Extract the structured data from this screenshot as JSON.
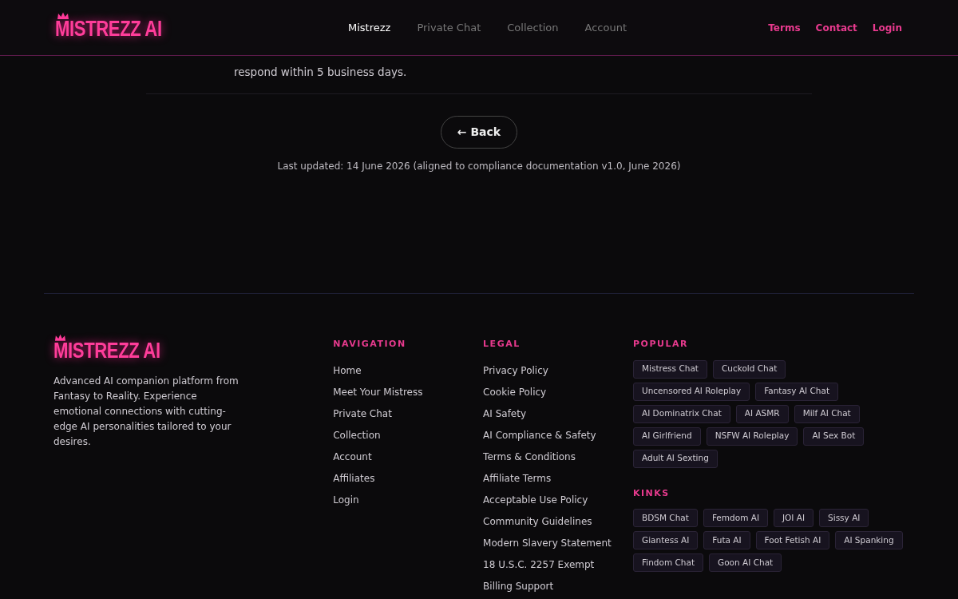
{
  "header": {
    "logo": "MISTREZZ AI",
    "nav": [
      {
        "label": "Mistrezz",
        "selected": true
      },
      {
        "label": "Private Chat",
        "selected": false
      },
      {
        "label": "Collection",
        "selected": false
      },
      {
        "label": "Account",
        "selected": false
      }
    ],
    "links": [
      "Terms",
      "Contact",
      "Login"
    ]
  },
  "content": {
    "paragraph": "respond within 5 business days.",
    "back_button": "← Back",
    "last_updated": "Last updated: 14 June 2026 (aligned to compliance documentation v1.0, June 2026)"
  },
  "footer": {
    "logo": "MISTREZZ AI",
    "description": "Advanced AI companion platform from Fantasy to Reality. Experience emotional connections with cutting-edge AI personalities tailored to your desires.",
    "columns": [
      {
        "title": "NAVIGATION",
        "links": [
          "Home",
          "Meet Your Mistress",
          "Private Chat",
          "Collection",
          "Account",
          "Affiliates",
          "Login"
        ]
      },
      {
        "title": "LEGAL",
        "links": [
          "Privacy Policy",
          "Cookie Policy",
          "AI Safety",
          "AI Compliance & Safety",
          "Terms & Conditions",
          "Affiliate Terms",
          "Acceptable Use Policy",
          "Community Guidelines",
          "Modern Slavery Statement",
          "18 U.S.C. 2257 Exempt",
          "Billing Support"
        ]
      }
    ],
    "tag_groups": [
      {
        "title": "POPULAR",
        "tags": [
          "Mistress Chat",
          "Cuckold Chat",
          "Uncensored AI Roleplay",
          "Fantasy AI Chat",
          "AI Dominatrix Chat",
          "AI ASMR",
          "Milf AI Chat",
          "AI Girlfriend",
          "NSFW AI Roleplay",
          "AI Sex Bot",
          "Adult AI Sexting"
        ]
      },
      {
        "title": "KINKS",
        "tags": [
          "BDSM Chat",
          "Femdom AI",
          "JOI AI",
          "Sissy AI",
          "Giantess AI",
          "Futa AI",
          "Foot Fetish AI",
          "AI Spanking",
          "Findom Chat",
          "Goon AI Chat"
        ]
      }
    ]
  }
}
